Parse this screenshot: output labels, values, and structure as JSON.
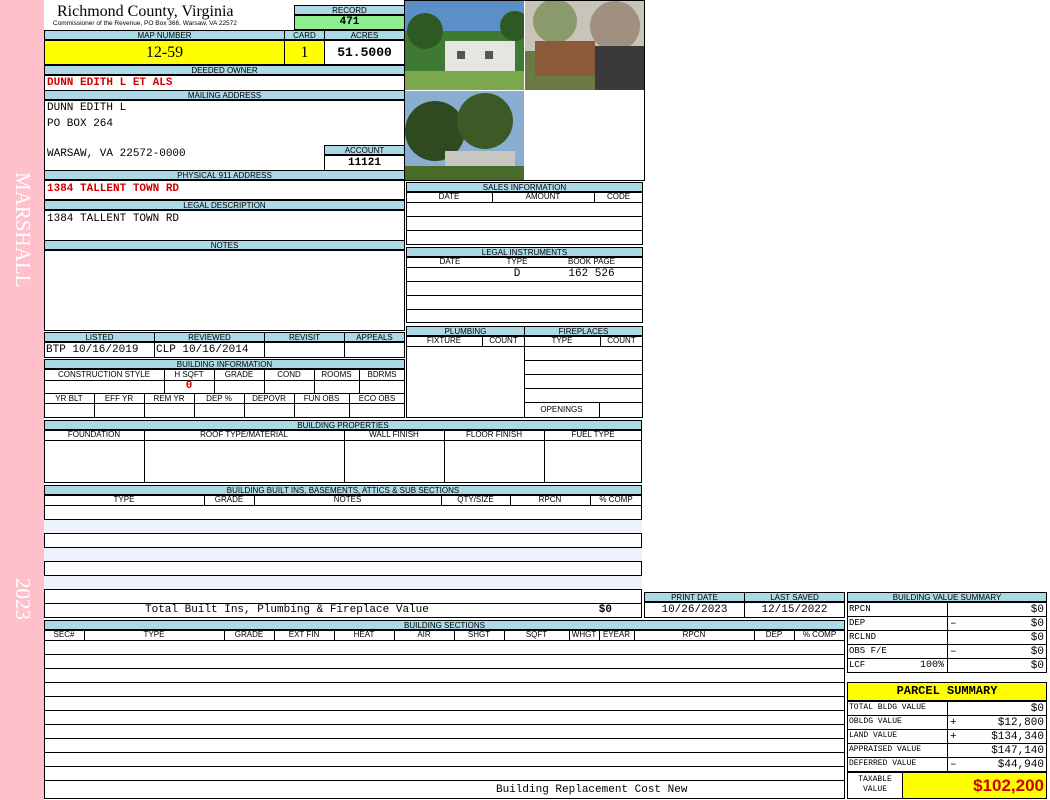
{
  "sidebar": {
    "name": "MARSHALL",
    "year": "2023"
  },
  "header": {
    "county": "Richmond County, Virginia",
    "commissioner": "Commissioner of the Revenue, PO Box 366, Warsaw, VA 22572",
    "record_label": "RECORD",
    "record": "471"
  },
  "map": {
    "map_label": "MAP NUMBER",
    "map_number": "12-59",
    "card_label": "CARD",
    "card": "1",
    "acres_label": "ACRES",
    "acres": "51.5000"
  },
  "owner": {
    "label": "DEEDED OWNER",
    "name": "DUNN EDITH L ET ALS"
  },
  "mailing": {
    "label": "MAILING ADDRESS",
    "line1": "DUNN EDITH L",
    "line2": "PO BOX 264",
    "line3": "WARSAW, VA 22572-0000"
  },
  "account": {
    "label": "ACCOUNT",
    "value": "11121"
  },
  "physical": {
    "label": "PHYSICAL 911 ADDRESS",
    "value": "1384 TALLENT TOWN RD"
  },
  "legal": {
    "label": "LEGAL DESCRIPTION",
    "value": "1384 TALLENT TOWN RD"
  },
  "notes": {
    "label": "NOTES"
  },
  "review": {
    "listed_label": "LISTED",
    "listed": "BTP 10/16/2019",
    "reviewed_label": "REVIEWED",
    "reviewed": "CLP 10/16/2014",
    "revisit_label": "REVISIT",
    "appeals_label": "APPEALS"
  },
  "building_info": {
    "label": "BUILDING INFORMATION",
    "cols1": [
      "CONSTRUCTION STYLE",
      "H SQFT",
      "GRADE",
      "COND",
      "ROOMS",
      "BDRMS"
    ],
    "hsqft": "0",
    "cols2": [
      "YR BLT",
      "EFF YR",
      "REM YR",
      "DEP %",
      "DEPOVR",
      "FUN OBS",
      "ECO OBS"
    ]
  },
  "sales": {
    "label": "SALES INFORMATION",
    "cols": [
      "DATE",
      "AMOUNT",
      "CODE"
    ]
  },
  "instruments": {
    "label": "LEGAL INSTRUMENTS",
    "cols": [
      "DATE",
      "TYPE",
      "BOOK PAGE"
    ],
    "type": "D",
    "book_page": "162 526"
  },
  "plumbing": {
    "label": "PLUMBING",
    "cols": [
      "FIXTURE",
      "COUNT"
    ]
  },
  "fireplaces": {
    "label": "FIREPLACES",
    "cols": [
      "TYPE",
      "COUNT"
    ],
    "openings": "OPENINGS"
  },
  "properties": {
    "label": "BUILDING PROPERTIES",
    "cols": [
      "FOUNDATION",
      "ROOF TYPE/MATERIAL",
      "WALL FINISH",
      "FLOOR FINISH",
      "FUEL TYPE"
    ]
  },
  "builtins": {
    "label": "BUILDING BUILT INS, BASEMENTS, ATTICS & SUB SECTIONS",
    "cols": [
      "TYPE",
      "GRADE",
      "NOTES",
      "QTY/SIZE",
      "RPCN",
      "% COMP"
    ],
    "total_label": "Total Built Ins, Plumbing & Fireplace Value",
    "total_value": "$0"
  },
  "dates": {
    "print_label": "PRINT DATE",
    "print_date": "10/26/2023",
    "saved_label": "LAST SAVED",
    "saved_date": "12/15/2022"
  },
  "sections": {
    "label": "BUILDING SECTIONS",
    "cols": [
      "SEC#",
      "TYPE",
      "GRADE",
      "EXT FIN",
      "HEAT",
      "AIR",
      "SHGT",
      "SQFT",
      "WHGT",
      "EYEAR",
      "RPCN",
      "DEP",
      "% COMP"
    ],
    "footer": "Building Replacement Cost New"
  },
  "value_summary": {
    "label": "BUILDING VALUE SUMMARY",
    "rows": [
      {
        "label": "RPCN",
        "sign": "",
        "value": "$0"
      },
      {
        "label": "DEP",
        "sign": "–",
        "value": "$0"
      },
      {
        "label": "RCLND",
        "sign": "",
        "value": "$0"
      },
      {
        "label": "OBS F/E",
        "sign": "–",
        "value": "$0"
      },
      {
        "label": "LCF",
        "pct": "100%",
        "sign": "",
        "value": "$0"
      }
    ]
  },
  "parcel": {
    "label": "PARCEL SUMMARY",
    "rows": [
      {
        "label": "TOTAL BLDG VALUE",
        "sign": "",
        "value": "$0"
      },
      {
        "label": "OBLDG VALUE",
        "sign": "+",
        "value": "$12,800"
      },
      {
        "label": "LAND VALUE",
        "sign": "+",
        "value": "$134,340"
      },
      {
        "label": "APPRAISED VALUE",
        "sign": "",
        "value": "$147,140"
      },
      {
        "label": "DEFERRED VALUE",
        "sign": "–",
        "value": "$44,940"
      }
    ],
    "taxable_label1": "TAXABLE",
    "taxable_label2": "VALUE",
    "taxable": "$102,200"
  },
  "colors": {
    "sidebar": "#ffc0cb",
    "header": "#add8e6",
    "highlight": "#ffff00",
    "record": "#90ee90",
    "red": "#d00000"
  }
}
